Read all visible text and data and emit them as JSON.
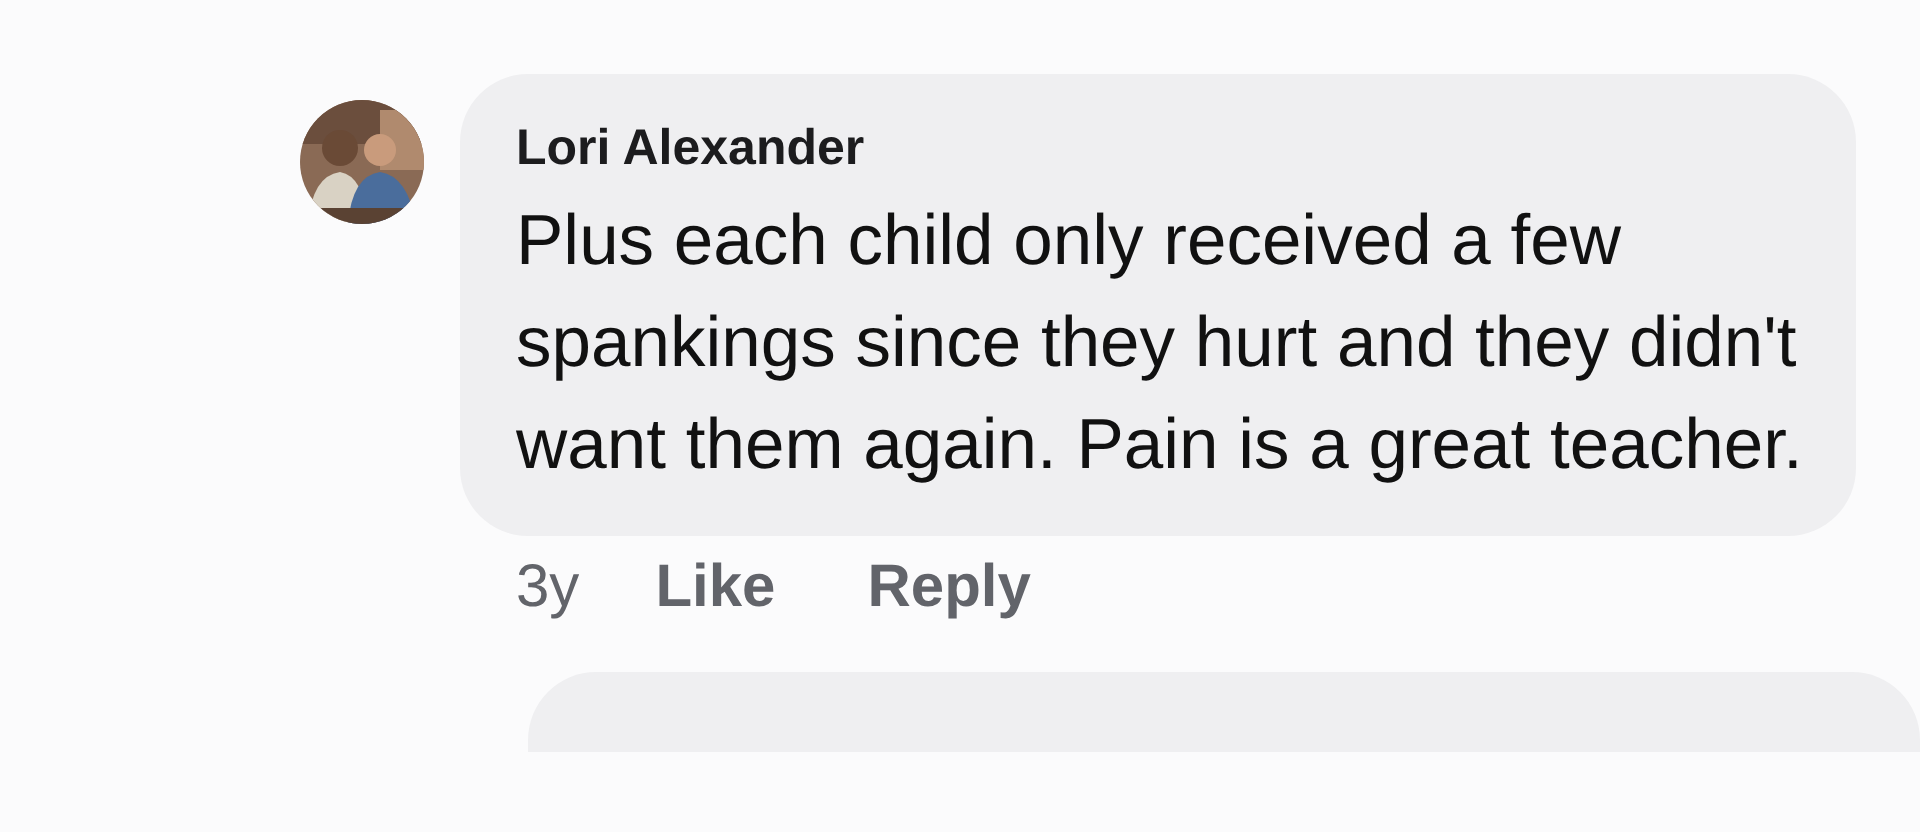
{
  "comments": [
    {
      "kind": "comment",
      "author": "Lori Alexander",
      "text": "Plus each child only received a few spankings since they hurt and they didn't want them again. Pain is a great teacher.",
      "actions": [
        "3y",
        "Like",
        "Reply"
      ]
    },
    {
      "kind": "partial"
    }
  ]
}
